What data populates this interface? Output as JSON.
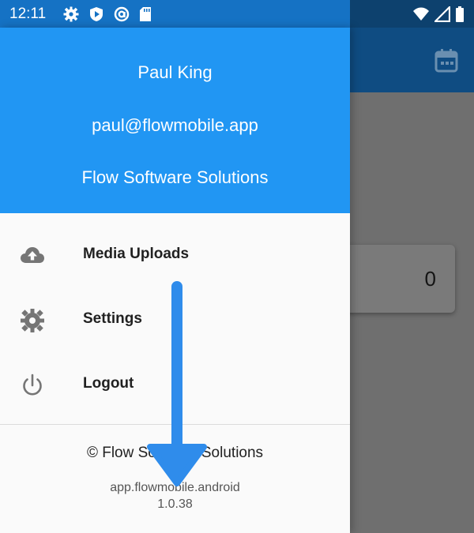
{
  "status_bar": {
    "time": "12:11",
    "left_icons": [
      "settings-icon",
      "shield-play-icon",
      "at-sign-icon",
      "sd-card-icon"
    ],
    "right_icons": [
      "wifi-icon",
      "signal-icon",
      "battery-icon"
    ]
  },
  "background_app": {
    "card_value": "0",
    "appbar_icon": "calendar-icon"
  },
  "drawer": {
    "header": {
      "name": "Paul King",
      "email": "paul@flowmobile.app",
      "company": "Flow Software Solutions",
      "background_color": "#2196f3"
    },
    "menu_items": [
      {
        "label": "Media Uploads",
        "icon": "cloud-upload-icon"
      },
      {
        "label": "Settings",
        "icon": "gear-icon"
      },
      {
        "label": "Logout",
        "icon": "power-icon"
      }
    ],
    "footer": {
      "copyright": "© Flow Software Solutions",
      "package": "app.flowmobile.android",
      "version": "1.0.38"
    }
  },
  "annotation": {
    "arrow_direction": "down",
    "arrow_color": "#2f8ceb"
  }
}
